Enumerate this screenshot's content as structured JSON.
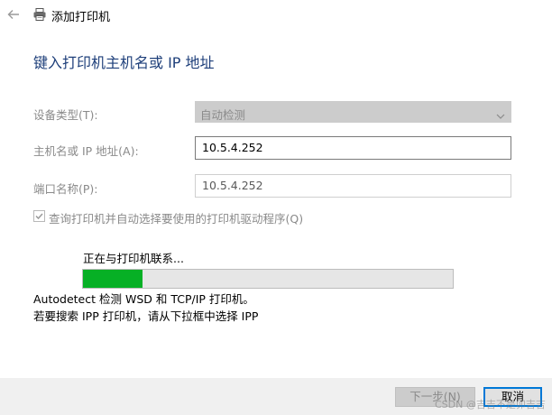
{
  "window": {
    "title": "添加打印机",
    "back_icon": "back-arrow-icon",
    "printer_icon": "printer-icon"
  },
  "heading": "键入打印机主机名或 IP 地址",
  "form": {
    "device_type": {
      "label": "设备类型(T):",
      "value": "自动检测",
      "disabled": true
    },
    "hostname": {
      "label": "主机名或 IP 地址(A):",
      "value": "10.5.4.252"
    },
    "port_name": {
      "label": "端口名称(P):",
      "value": "10.5.4.252"
    },
    "auto_query": {
      "label": "查询打印机并自动选择要使用的打印机驱动程序(Q)",
      "checked": true,
      "disabled": true
    }
  },
  "progress": {
    "status": "正在与打印机联系...",
    "fraction": 0.16,
    "color": "#06b025"
  },
  "info": {
    "line1": "Autodetect 检测 WSD 和 TCP/IP 打印机。",
    "line2": "若要搜索 IPP 打印机，请从下拉框中选择 IPP"
  },
  "footer": {
    "next_label": "下一步(N)",
    "cancel_label": "取消"
  },
  "watermark": "CSDN @吉吉不是卯吉吉",
  "colors": {
    "heading": "#1e3f7a",
    "accent_border": "#0078d7",
    "disabled_text": "#8a8a8a"
  }
}
